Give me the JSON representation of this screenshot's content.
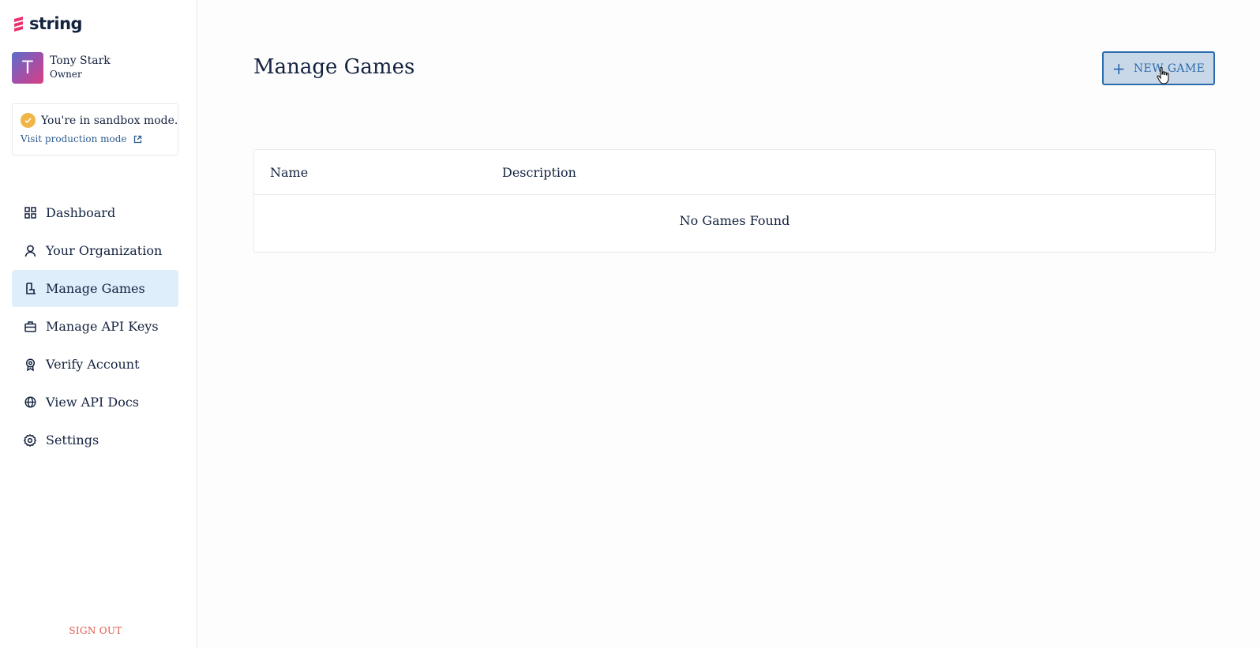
{
  "brand": {
    "logo_text": "string",
    "logo_color": "#e8316f"
  },
  "user": {
    "initial": "T",
    "name": "Tony Stark",
    "role": "Owner"
  },
  "sandbox": {
    "message": "You're in sandbox mode.",
    "link_label": "Visit production mode",
    "icon": "check-circle-icon",
    "link_icon": "external-link-icon"
  },
  "nav": {
    "items": [
      {
        "label": "Dashboard",
        "icon": "grid-icon"
      },
      {
        "label": "Your Organization",
        "icon": "user-icon"
      },
      {
        "label": "Manage Games",
        "icon": "game-icon",
        "active": true
      },
      {
        "label": "Manage API Keys",
        "icon": "briefcase-icon"
      },
      {
        "label": "Verify Account",
        "icon": "badge-icon"
      },
      {
        "label": "View API Docs",
        "icon": "globe-icon"
      },
      {
        "label": "Settings",
        "icon": "gear-icon"
      }
    ]
  },
  "sign_out_label": "SIGN OUT",
  "main": {
    "title": "Manage Games",
    "new_game_label": "NEW GAME",
    "table": {
      "columns": [
        "Name",
        "Description"
      ],
      "empty_message": "No Games Found"
    }
  }
}
